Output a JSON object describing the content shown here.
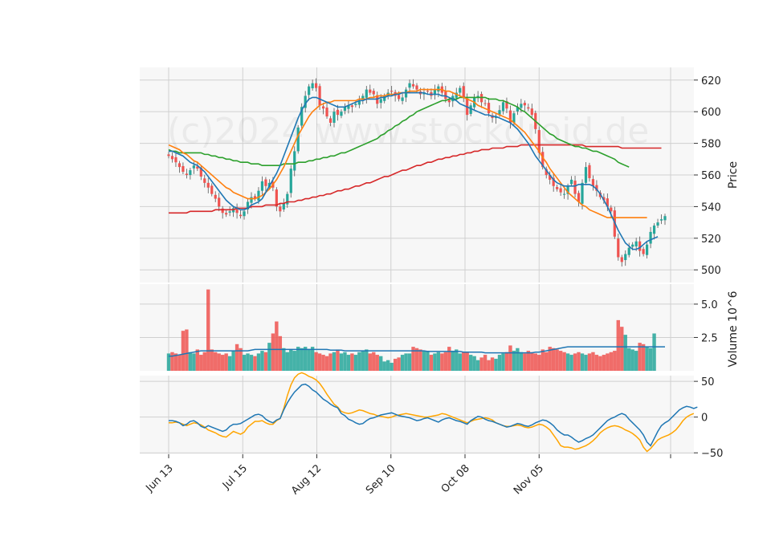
{
  "watermark": "(c)2024 www.stockdroid.de",
  "chart_data": {
    "type": "candlestick",
    "x_ticks": [
      "Jun 13",
      "Jul 15",
      "Aug 12",
      "Sep 10",
      "Oct 08",
      "Nov 05"
    ],
    "price_panel": {
      "ylabel": "Price",
      "ylim": [
        492,
        628
      ],
      "yticks": [
        500,
        520,
        540,
        560,
        580,
        600,
        620
      ],
      "grid": true,
      "closes": [
        572,
        570,
        568,
        565,
        562,
        560,
        563,
        566,
        564,
        559,
        555,
        552,
        548,
        545,
        540,
        536,
        535,
        537,
        539,
        536,
        534,
        537,
        543,
        546,
        545,
        550,
        556,
        553,
        555,
        552,
        540,
        537,
        542,
        548,
        564,
        575,
        590,
        603,
        610,
        616,
        618,
        615,
        604,
        602,
        597,
        593,
        600,
        598,
        600,
        603,
        604,
        603,
        605,
        607,
        610,
        614,
        612,
        611,
        605,
        608,
        610,
        612,
        613,
        610,
        608,
        609,
        614,
        618,
        616,
        614,
        611,
        612,
        613,
        610,
        614,
        616,
        612,
        608,
        606,
        610,
        612,
        615,
        609,
        598,
        604,
        609,
        610,
        606,
        605,
        599,
        596,
        597,
        601,
        606,
        602,
        593,
        599,
        603,
        605,
        604,
        602,
        598,
        589,
        574,
        565,
        560,
        557,
        553,
        551,
        549,
        548,
        553,
        557,
        548,
        543,
        555,
        565,
        558,
        553,
        550,
        546,
        544,
        540,
        537,
        521,
        508,
        505,
        510,
        514,
        516,
        518,
        512,
        510,
        516,
        524,
        528,
        530,
        532,
        534
      ],
      "sma_fast": {
        "color": "#1f77b4",
        "from": 0,
        "values": [
          575,
          575,
          574,
          573,
          572,
          570,
          568,
          567,
          566,
          564,
          562,
          559,
          556,
          553,
          550,
          547,
          544,
          542,
          540,
          539,
          538,
          538,
          539,
          541,
          542,
          543,
          545,
          549,
          553,
          557,
          561,
          566,
          572,
          578,
          584,
          590,
          596,
          601,
          605,
          608,
          609,
          609,
          608,
          607,
          606,
          605,
          604,
          603,
          603,
          603,
          604,
          605,
          606,
          607,
          607,
          608,
          608,
          608,
          608,
          609,
          609,
          610,
          610,
          611,
          611,
          612,
          612,
          612,
          612,
          612,
          612,
          612,
          611,
          611,
          611,
          611,
          610,
          610,
          609,
          608,
          607,
          605,
          604,
          603,
          602,
          601,
          600,
          599,
          598,
          598,
          597,
          597,
          596,
          595,
          594,
          593,
          591,
          589,
          586,
          583,
          580,
          576,
          572,
          569,
          566,
          563,
          560,
          557,
          555,
          554,
          553,
          553,
          553,
          553,
          554,
          554,
          554,
          554,
          553,
          551,
          548,
          544,
          540,
          535,
          530,
          525,
          521,
          517,
          515,
          513,
          513,
          514,
          516,
          518,
          519,
          520,
          521
        ]
      },
      "sma_mid": {
        "color": "#ff7f0e",
        "from": 0,
        "values": [
          579,
          578,
          577,
          576,
          574,
          573,
          571,
          569,
          568,
          566,
          564,
          562,
          560,
          558,
          556,
          554,
          552,
          551,
          549,
          548,
          547,
          546,
          545,
          545,
          545,
          546,
          547,
          549,
          551,
          554,
          557,
          561,
          565,
          570,
          575,
          580,
          585,
          589,
          593,
          597,
          600,
          602,
          604,
          605,
          606,
          606,
          607,
          607,
          607,
          607,
          607,
          607,
          607,
          608,
          608,
          608,
          609,
          609,
          610,
          610,
          610,
          611,
          611,
          611,
          612,
          612,
          612,
          613,
          613,
          613,
          614,
          614,
          614,
          614,
          614,
          614,
          614,
          613,
          613,
          612,
          611,
          610,
          609,
          608,
          607,
          606,
          604,
          603,
          602,
          601,
          600,
          599,
          598,
          597,
          596,
          595,
          593,
          591,
          589,
          587,
          584,
          581,
          578,
          575,
          571,
          568,
          564,
          561,
          558,
          555,
          552,
          549,
          547,
          545,
          543,
          541,
          540,
          538,
          537,
          536,
          535,
          534,
          533,
          533,
          533,
          533,
          533,
          533,
          533,
          533,
          533,
          533,
          533,
          533
        ]
      },
      "sma_slow": {
        "color": "#2ca02c",
        "from": 0,
        "values": [
          576,
          575,
          575,
          574,
          574,
          574,
          574,
          574,
          574,
          574,
          573,
          573,
          572,
          572,
          571,
          571,
          570,
          570,
          569,
          569,
          568,
          568,
          568,
          567,
          567,
          567,
          566,
          566,
          566,
          566,
          566,
          566,
          567,
          567,
          567,
          567,
          568,
          568,
          568,
          569,
          569,
          570,
          570,
          571,
          571,
          572,
          572,
          573,
          574,
          574,
          575,
          576,
          577,
          578,
          579,
          580,
          581,
          582,
          583,
          585,
          586,
          588,
          589,
          591,
          592,
          594,
          595,
          597,
          598,
          600,
          601,
          602,
          603,
          604,
          605,
          606,
          607,
          607,
          608,
          608,
          608,
          609,
          609,
          609,
          609,
          609,
          609,
          609,
          609,
          608,
          608,
          608,
          607,
          607,
          606,
          605,
          604,
          603,
          601,
          600,
          598,
          596,
          594,
          592,
          590,
          588,
          586,
          585,
          583,
          582,
          581,
          580,
          579,
          578,
          578,
          577,
          577,
          576,
          575,
          575,
          574,
          573,
          572,
          571,
          570,
          568,
          567,
          566,
          565
        ]
      },
      "sma_long": {
        "color": "#d62728",
        "from": 0,
        "values": [
          536,
          536,
          536,
          536,
          536,
          536,
          537,
          537,
          537,
          537,
          537,
          537,
          537,
          538,
          538,
          538,
          538,
          538,
          538,
          539,
          539,
          539,
          539,
          540,
          540,
          540,
          540,
          541,
          541,
          541,
          541,
          542,
          542,
          543,
          543,
          543,
          544,
          544,
          545,
          545,
          546,
          546,
          547,
          547,
          548,
          548,
          549,
          550,
          550,
          551,
          551,
          552,
          553,
          553,
          554,
          555,
          555,
          556,
          557,
          558,
          559,
          559,
          560,
          561,
          562,
          563,
          563,
          564,
          565,
          566,
          566,
          567,
          568,
          568,
          569,
          570,
          570,
          571,
          571,
          572,
          572,
          573,
          573,
          574,
          574,
          575,
          575,
          576,
          576,
          576,
          577,
          577,
          577,
          577,
          578,
          578,
          578,
          578,
          579,
          579,
          579,
          579,
          579,
          579,
          579,
          579,
          579,
          579,
          579,
          579,
          579,
          579,
          579,
          579,
          579,
          579,
          578,
          578,
          578,
          578,
          578,
          578,
          578,
          578,
          578,
          578,
          577,
          577,
          577,
          577,
          577,
          577,
          577,
          577,
          577,
          577,
          577,
          577
        ]
      }
    },
    "volume_panel": {
      "ylabel": "Volume  10^6",
      "ylim": [
        0,
        6.5
      ],
      "yticks": [
        "2.5",
        "5.0"
      ],
      "values_millions": [
        1.3,
        1.4,
        1.3,
        1.2,
        3.0,
        3.1,
        1.4,
        1.3,
        1.6,
        1.2,
        1.4,
        6.1,
        1.6,
        1.4,
        1.3,
        1.2,
        1.3,
        1.1,
        1.5,
        2.0,
        1.7,
        1.2,
        1.3,
        1.2,
        1.1,
        1.3,
        1.5,
        1.4,
        2.1,
        2.8,
        3.7,
        2.6,
        1.7,
        1.4,
        1.6,
        1.5,
        1.8,
        1.7,
        1.8,
        1.6,
        1.8,
        1.4,
        1.3,
        1.2,
        1.1,
        1.3,
        1.4,
        1.6,
        1.3,
        1.4,
        1.2,
        1.3,
        1.2,
        1.4,
        1.5,
        1.6,
        1.3,
        1.4,
        1.2,
        1.1,
        0.7,
        0.8,
        0.6,
        0.9,
        1.0,
        1.2,
        1.3,
        1.3,
        1.8,
        1.7,
        1.6,
        1.5,
        1.5,
        1.2,
        1.3,
        1.4,
        1.3,
        1.4,
        1.8,
        1.5,
        1.6,
        1.3,
        1.4,
        1.4,
        1.2,
        1.1,
        0.8,
        1.0,
        1.2,
        0.8,
        1.0,
        0.9,
        1.2,
        1.3,
        1.4,
        1.9,
        1.5,
        1.7,
        1.4,
        1.3,
        1.5,
        1.4,
        1.3,
        1.2,
        1.6,
        1.4,
        1.8,
        1.7,
        1.6,
        1.5,
        1.4,
        1.3,
        1.2,
        1.3,
        1.4,
        1.3,
        1.2,
        1.3,
        1.4,
        1.2,
        1.1,
        1.2,
        1.3,
        1.4,
        1.5,
        3.8,
        3.3,
        2.7,
        1.7,
        1.6,
        1.5,
        2.1,
        2.0,
        1.8,
        1.7,
        2.8
      ],
      "up_color": "#26a69a",
      "down_color": "#ef5350",
      "avg_color": "#1f77b4",
      "avg_millions": [
        1.1,
        1.1,
        1.15,
        1.2,
        1.25,
        1.3,
        1.35,
        1.4,
        1.45,
        1.5,
        1.5,
        1.5,
        1.5,
        1.5,
        1.5,
        1.5,
        1.5,
        1.5,
        1.5,
        1.5,
        1.5,
        1.5,
        1.5,
        1.55,
        1.6,
        1.6,
        1.6,
        1.6,
        1.6,
        1.6,
        1.6,
        1.6,
        1.6,
        1.6,
        1.6,
        1.6,
        1.6,
        1.6,
        1.6,
        1.6,
        1.6,
        1.6,
        1.6,
        1.6,
        1.6,
        1.55,
        1.55,
        1.55,
        1.55,
        1.5,
        1.5,
        1.5,
        1.5,
        1.5,
        1.5,
        1.5,
        1.5,
        1.5,
        1.5,
        1.5,
        1.5,
        1.5,
        1.5,
        1.5,
        1.5,
        1.5,
        1.5,
        1.5,
        1.5,
        1.5,
        1.5,
        1.5,
        1.45,
        1.45,
        1.45,
        1.45,
        1.45,
        1.45,
        1.45,
        1.45,
        1.45,
        1.45,
        1.4,
        1.4,
        1.4,
        1.4,
        1.4,
        1.4,
        1.35,
        1.35,
        1.35,
        1.35,
        1.35,
        1.35,
        1.35,
        1.35,
        1.35,
        1.35,
        1.35,
        1.35,
        1.35,
        1.35,
        1.4,
        1.4,
        1.45,
        1.5,
        1.55,
        1.6,
        1.65,
        1.7,
        1.75,
        1.8,
        1.8,
        1.8,
        1.8,
        1.8,
        1.8,
        1.8,
        1.8,
        1.8,
        1.8,
        1.8,
        1.8,
        1.8,
        1.8,
        1.8,
        1.8,
        1.8,
        1.8,
        1.8,
        1.8,
        1.8,
        1.8,
        1.8,
        1.8,
        1.8,
        1.8,
        1.8,
        1.8
      ]
    },
    "oscillator_panel": {
      "ylim": [
        -52,
        58
      ],
      "yticks": [
        -50,
        0,
        50
      ],
      "line1": {
        "color": "#1f77b4",
        "values": [
          -5,
          -5,
          -6,
          -8,
          -12,
          -10,
          -6,
          -5,
          -8,
          -13,
          -15,
          -12,
          -14,
          -16,
          -18,
          -20,
          -18,
          -13,
          -10,
          -10,
          -9,
          -6,
          -3,
          0,
          3,
          4,
          2,
          -3,
          -6,
          -8,
          -4,
          -2,
          10,
          20,
          28,
          35,
          40,
          45,
          46,
          43,
          38,
          35,
          30,
          25,
          22,
          18,
          15,
          13,
          5,
          2,
          -3,
          -5,
          -8,
          -10,
          -9,
          -5,
          -2,
          -1,
          1,
          3,
          4,
          5,
          6,
          4,
          2,
          1,
          0,
          -1,
          -3,
          -5,
          -4,
          -2,
          -1,
          -3,
          -5,
          -7,
          -4,
          -2,
          -1,
          -3,
          -5,
          -6,
          -8,
          -10,
          -5,
          -2,
          1,
          0,
          -3,
          -5,
          -6,
          -8,
          -10,
          -12,
          -14,
          -13,
          -11,
          -9,
          -10,
          -12,
          -13,
          -11,
          -8,
          -6,
          -4,
          -5,
          -8,
          -12,
          -18,
          -22,
          -25,
          -25,
          -28,
          -32,
          -35,
          -33,
          -30,
          -28,
          -25,
          -20,
          -15,
          -10,
          -5,
          -2,
          0,
          3,
          5,
          3,
          -3,
          -8,
          -13,
          -18,
          -25,
          -35,
          -40,
          -30,
          -20,
          -12,
          -8,
          -5,
          0,
          5,
          10,
          13,
          15,
          14,
          12,
          14
        ]
      },
      "line2": {
        "color": "#ffa500",
        "values": [
          -8,
          -8,
          -7,
          -8,
          -10,
          -12,
          -10,
          -8,
          -9,
          -11,
          -14,
          -18,
          -20,
          -22,
          -25,
          -27,
          -28,
          -24,
          -20,
          -22,
          -24,
          -21,
          -14,
          -10,
          -6,
          -6,
          -5,
          -8,
          -10,
          -10,
          -5,
          -2,
          12,
          30,
          45,
          55,
          60,
          62,
          60,
          57,
          55,
          52,
          47,
          40,
          32,
          25,
          18,
          14,
          8,
          6,
          5,
          6,
          8,
          10,
          9,
          7,
          5,
          4,
          2,
          1,
          0,
          -1,
          0,
          2,
          3,
          4,
          5,
          4,
          3,
          2,
          1,
          0,
          0,
          1,
          2,
          3,
          5,
          4,
          2,
          0,
          -2,
          -4,
          -6,
          -8,
          -6,
          -4,
          -3,
          -2,
          -1,
          -2,
          -4,
          -8,
          -10,
          -12,
          -13,
          -13,
          -12,
          -11,
          -12,
          -14,
          -15,
          -14,
          -12,
          -10,
          -11,
          -14,
          -18,
          -25,
          -32,
          -40,
          -42,
          -42,
          -43,
          -45,
          -44,
          -42,
          -40,
          -37,
          -33,
          -28,
          -22,
          -18,
          -15,
          -13,
          -12,
          -13,
          -15,
          -18,
          -20,
          -23,
          -27,
          -32,
          -42,
          -48,
          -44,
          -38,
          -32,
          -29,
          -27,
          -25,
          -22,
          -18,
          -12,
          -5,
          0,
          3,
          5
        ]
      }
    }
  }
}
